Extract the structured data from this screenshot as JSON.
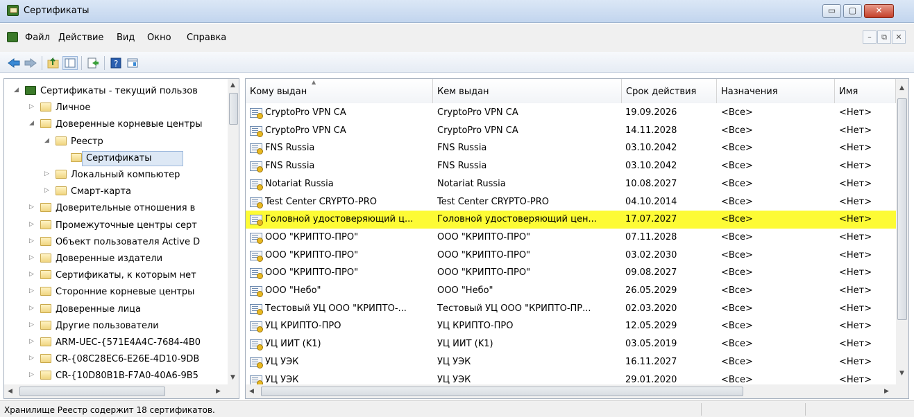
{
  "window": {
    "title": "Сертификаты"
  },
  "window_buttons": {
    "minimize": "▭",
    "maximize": "▢",
    "close": "✕"
  },
  "mdi_buttons": {
    "minimize": "–",
    "restore": "⧉",
    "close": "✕"
  },
  "menu": {
    "items": [
      "Файл",
      "Действие",
      "Вид",
      "Окно",
      "Справка"
    ]
  },
  "toolbar": {
    "icons": [
      "back-arrow-icon",
      "forward-arrow-icon",
      "up-folder-icon",
      "show-tree-icon",
      "export-icon",
      "help-icon",
      "properties-icon"
    ]
  },
  "tree": {
    "items": [
      {
        "label": "Сертификаты - текущий пользов",
        "expander": "◢"
      },
      {
        "label": "Личное",
        "expander": "▷"
      },
      {
        "label": "Доверенные корневые центры",
        "expander": "◢"
      },
      {
        "label": "Реестр",
        "expander": "◢"
      },
      {
        "label": "Сертификаты",
        "expander": ""
      },
      {
        "label": "Локальный компьютер",
        "expander": "▷"
      },
      {
        "label": "Смарт-карта",
        "expander": "▷"
      },
      {
        "label": "Доверительные отношения в",
        "expander": "▷"
      },
      {
        "label": "Промежуточные центры серт",
        "expander": "▷"
      },
      {
        "label": "Объект пользователя Active D",
        "expander": "▷"
      },
      {
        "label": "Доверенные издатели",
        "expander": "▷"
      },
      {
        "label": "Сертификаты, к которым нет",
        "expander": "▷"
      },
      {
        "label": "Сторонние корневые центры",
        "expander": "▷"
      },
      {
        "label": "Доверенные лица",
        "expander": "▷"
      },
      {
        "label": "Другие пользователи",
        "expander": "▷"
      },
      {
        "label": "ARM-UEC-{571E4A4C-7684-4B0",
        "expander": "▷"
      },
      {
        "label": "CR-{08C28EC6-E26E-4D10-9DB",
        "expander": "▷"
      },
      {
        "label": "CR-{10D80B1B-F7A0-40A6-9B5",
        "expander": "▷"
      }
    ]
  },
  "list": {
    "columns": [
      "Кому выдан",
      "Кем выдан",
      "Срок действия",
      "Назначения",
      "Имя"
    ],
    "rows": [
      [
        "CryptoPro VPN CA",
        "CryptoPro VPN CA",
        "19.09.2026",
        "<Все>",
        "<Нет>"
      ],
      [
        "CryptoPro VPN CA",
        "CryptoPro VPN CA",
        "14.11.2028",
        "<Все>",
        "<Нет>"
      ],
      [
        "FNS Russia",
        "FNS Russia",
        "03.10.2042",
        "<Все>",
        "<Нет>"
      ],
      [
        "FNS Russia",
        "FNS Russia",
        "03.10.2042",
        "<Все>",
        "<Нет>"
      ],
      [
        "Notariat Russia",
        "Notariat Russia",
        "10.08.2027",
        "<Все>",
        "<Нет>"
      ],
      [
        "Test Center CRYPTO-PRO",
        "Test Center CRYPTO-PRO",
        "04.10.2014",
        "<Все>",
        "<Нет>"
      ],
      [
        "Головной удостоверяющий ц...",
        "Головной удостоверяющий цен...",
        "17.07.2027",
        "<Все>",
        "<Нет>"
      ],
      [
        "ООО \"КРИПТО-ПРО\"",
        "ООО \"КРИПТО-ПРО\"",
        "07.11.2028",
        "<Все>",
        "<Нет>"
      ],
      [
        "ООО \"КРИПТО-ПРО\"",
        "ООО \"КРИПТО-ПРО\"",
        "03.02.2030",
        "<Все>",
        "<Нет>"
      ],
      [
        "ООО \"КРИПТО-ПРО\"",
        "ООО \"КРИПТО-ПРО\"",
        "09.08.2027",
        "<Все>",
        "<Нет>"
      ],
      [
        "ООО \"Небо\"",
        "ООО \"Небо\"",
        "26.05.2029",
        "<Все>",
        "<Нет>"
      ],
      [
        "Тестовый УЦ ООО \"КРИПТО-...",
        "Тестовый УЦ ООО \"КРИПТО-ПР...",
        "02.03.2020",
        "<Все>",
        "<Нет>"
      ],
      [
        "УЦ КРИПТО-ПРО",
        "УЦ КРИПТО-ПРО",
        "12.05.2029",
        "<Все>",
        "<Нет>"
      ],
      [
        "УЦ ИИТ (K1)",
        "УЦ ИИТ (K1)",
        "03.05.2019",
        "<Все>",
        "<Нет>"
      ],
      [
        "УЦ УЭК",
        "УЦ УЭК",
        "16.11.2027",
        "<Все>",
        "<Нет>"
      ],
      [
        "УЦ УЭК",
        "УЦ УЭК",
        "29.01.2020",
        "<Все>",
        "<Нет>"
      ]
    ],
    "highlighted_row": 6,
    "highlight_color": "#fdfb35"
  },
  "status": {
    "text": "Хранилище Реестр содержит 18 сертификатов."
  }
}
